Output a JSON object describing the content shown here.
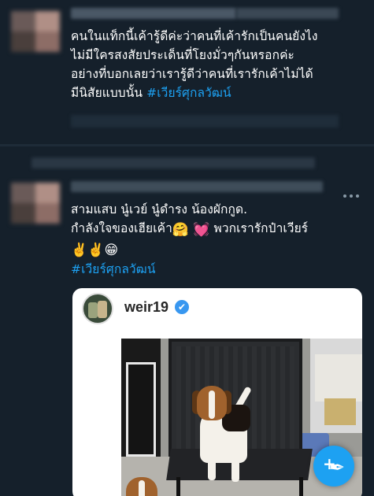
{
  "tweet1": {
    "lines": [
      "คนในแท็กนี้เค้ารู้ดีค่ะว่าคนที่เค้ารักเป็นคนยังไง",
      "ไม่มีใครสงสัยประเด็นที่โยงมั่วๆกันหรอกค่ะ",
      "อย่างที่บอกเลยว่าเรารู้ดีว่าคนที่เรารักเค้าไม่ได้",
      "มีนิสัยแบบนั้น"
    ],
    "hashtag": "#เวียร์ศุกลวัฒน์"
  },
  "tweet2": {
    "line1": "สามแสบ นู๋เวย์ นู๋ดำรง น้องผักกูด.",
    "line2_text": "กำลังใจของเฮียเค้า",
    "line2_emoji1": "🤗",
    "line2_emoji2": "💓",
    "line2_tail": "พวกเรารักป๋าเวียร์",
    "line3_emojis": "✌️✌️😁",
    "hashtag": "#เวียร์ศุกลวัฒน์",
    "embed": {
      "username": "weir19",
      "verified_icon": "✔"
    }
  },
  "compose": {
    "plus": "+",
    "quill": "✒"
  },
  "colors": {
    "background": "#15202b",
    "accent": "#1da1f2"
  }
}
